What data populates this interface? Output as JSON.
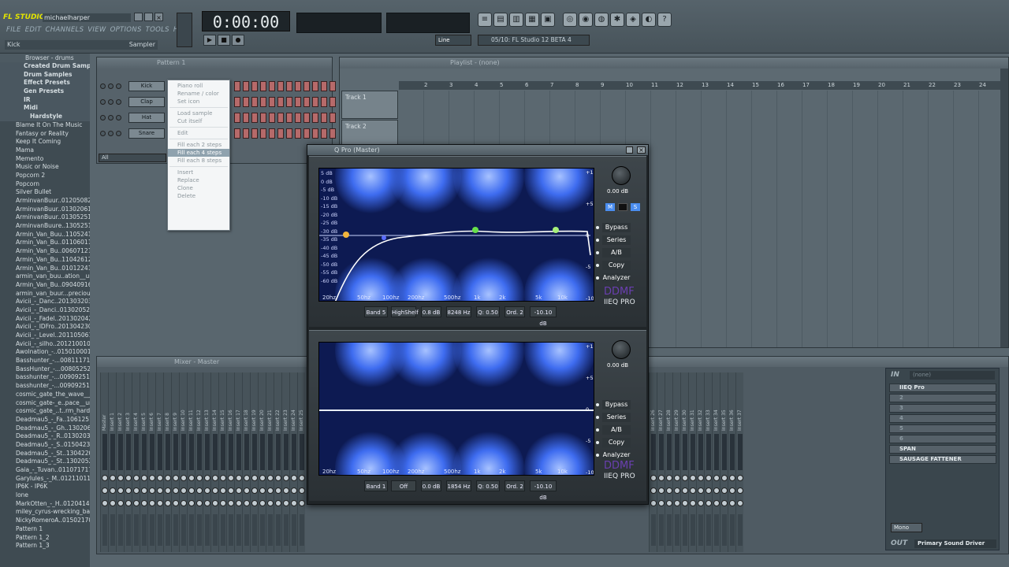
{
  "app": {
    "logo": "FL STUDIO",
    "user": "michaelharper",
    "time": "0:00:00"
  },
  "menu": [
    "FILE",
    "EDIT",
    "CHANNELS",
    "VIEW",
    "OPTIONS",
    "TOOLS",
    "HELP"
  ],
  "hint": {
    "left": "Kick",
    "right": "Sampler"
  },
  "news": "05/10: FL Studio 12 BETA 4",
  "browser": {
    "title": "Browser - drums",
    "folders": [
      "Created Drum Samples",
      "Drum Samples",
      "Effect Presets",
      "Gen Presets",
      "IR",
      "Midi",
      "Hardstyle"
    ],
    "items": [
      "Blame It On The Music",
      "Fantasy or Reality",
      "Keep It Coming",
      "Mama",
      "Memento",
      "Music or Noise",
      "Popcorn 2",
      "Popcorn",
      "Silver Bullet",
      "ArminvanBuur..0120508215144",
      "ArminvanBuur..0130206102319",
      "ArminvanBuur..0130525104634",
      "ArminvanBuure..130525104717",
      "Armin_Van_Buu..110524174011",
      "Armin_Van_Bu..0110601105525",
      "Armin_Van_Bu..0060712112036",
      "Armin_Van_Bu..110426120917",
      "Armin_Van_Bu..0101224152716",
      "armin_van_buu..ation__unknown",
      "Armin_Van_Bu..090409161025",
      "armin_van_buur...precious__dc",
      "Avicii_-_Danc..20130320321059",
      "Avicii_-_Danci..0130205230393",
      "Avicii_-_Fadel..20130204211918",
      "Avicii_-_IDFro..20130423003057",
      "Avicii_-_Level..20110506102201",
      "Avicii_-_silho..20121001014348",
      "Awolnation_-..015010001340",
      "Basshunter_-...0081117145857",
      "BassHunter_-...0080525231759",
      "basshunter_-...0090925145030",
      "basshunter_-...0090925145115",
      "cosmic_gate_the_wave__john",
      "cosmic_gate-_e..pace__unknown",
      "cosmic_gate_..t..rm_hardtrance",
      "Deadmau5_-_Fa..106125163657",
      "Deadmau5_-_Gh..130206072807",
      "Deadmau5_-_R..0130203210126",
      "Deadmau5_-_S..0150423003038",
      "Deadmau5_-_St..130422041741",
      "Deadmau5_-_St..130205221241",
      "Gaia_-_Tuvan..0110717173228",
      "Garylules_-_M..0121101192118",
      "IP6K - IP6K",
      "lone",
      "MarkOtten_-_H..0120414093251",
      "miley_cyrus-wrecking_ball",
      "NickyRomeroA..0150217010500",
      "Pattern 1",
      "Pattern 1_2",
      "Pattern 1_3"
    ]
  },
  "rack": {
    "pattern": "Pattern 1",
    "filter": "All",
    "channels": [
      "Kick",
      "Clap",
      "Hat",
      "Snare"
    ]
  },
  "context_menu": [
    "Piano roll",
    "Rename / color",
    "Set icon",
    "Load sample",
    "Cut itself",
    "Edit",
    "Fill each 2 steps",
    "Fill each 4 steps",
    "Fill each 8 steps",
    "Insert",
    "Replace",
    "Clone",
    "Delete"
  ],
  "playlist": {
    "title": "Playlist - (none)",
    "tracks": [
      "Track 1",
      "Track 2"
    ],
    "bars": [
      "2",
      "3",
      "4",
      "5",
      "6",
      "7",
      "8",
      "9",
      "10",
      "11",
      "12",
      "13",
      "14",
      "15",
      "16",
      "17",
      "18",
      "19",
      "20",
      "21",
      "22",
      "23",
      "24"
    ]
  },
  "mixer": {
    "title": "Mixer - Master",
    "master": "Master",
    "insert_prefix": "Insert",
    "inserts_panel": {
      "in": "IN",
      "in_value": "(none)",
      "slots": [
        "IIEQ Pro",
        "2",
        "3",
        "4",
        "5",
        "6",
        "SPAN",
        "SAUSAGE FATTENER"
      ],
      "out": "OUT",
      "out_value": "Primary Sound Driver",
      "mode": "Mono"
    }
  },
  "eq": {
    "title": "Q Pro (Master)",
    "db_labels": [
      "5 dB",
      "0 dB",
      "-5 dB",
      "-10 dB",
      "-15 dB",
      "-20 dB",
      "-25 dB",
      "-30 dB",
      "-35 dB",
      "-40 dB",
      "-45 dB",
      "-50 dB",
      "-55 dB",
      "-60 dB"
    ],
    "hz_labels": [
      "20hz",
      "50hz",
      "100hz",
      "200hz",
      "500hz",
      "1k",
      "2k",
      "5k",
      "10k"
    ],
    "right_scale": [
      "+10",
      "+5",
      "0",
      "-5",
      "-10"
    ],
    "gain": "0.00 dB",
    "side_buttons": [
      "Bypass",
      "Series",
      "A/B",
      "Copy",
      "Analyzer"
    ],
    "brand": "DDMF",
    "product": "IIEQ PRO",
    "top_bar": [
      "Band 5",
      "HighShelf",
      "0.8 dB",
      "8248 Hz",
      "Q: 0.50",
      "Ord. 2",
      "-10.10 dB"
    ],
    "bottom_bar": [
      "Band 1",
      "Off",
      "0.0 dB",
      "1854 Hz",
      "Q: 0.50",
      "Ord. 2",
      "-10.10 dB"
    ],
    "ms_buttons": [
      "M",
      "S"
    ]
  },
  "colors": {
    "accent": "#e2e200",
    "step": "#b66a6a",
    "eq_bg": "#0d1a52",
    "eq_blob": "#3e6cf0"
  }
}
